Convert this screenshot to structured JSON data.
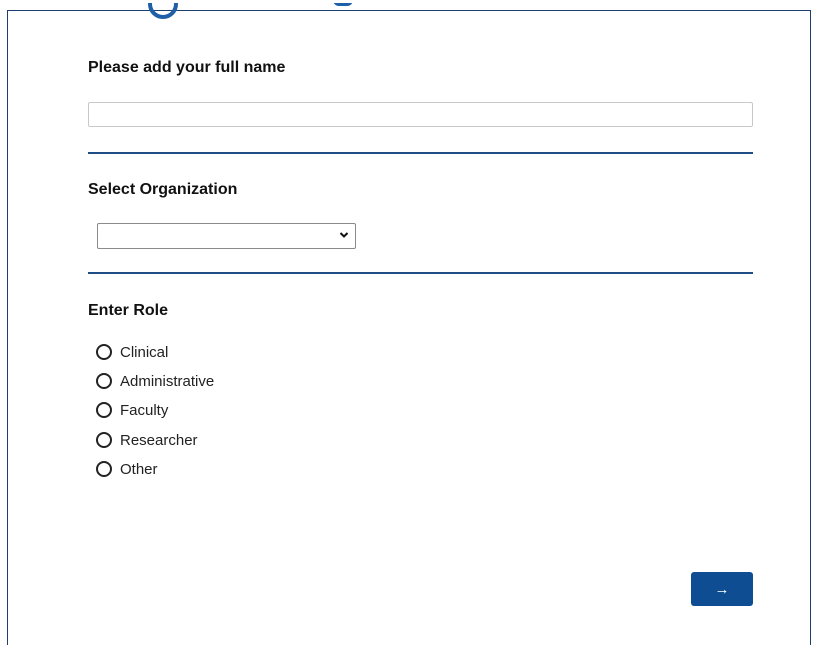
{
  "questions": {
    "full_name": {
      "label": "Please add your full name",
      "value": "",
      "placeholder": ""
    },
    "organization": {
      "label": "Select Organization",
      "selected": ""
    },
    "role": {
      "label": "Enter Role",
      "options": [
        "Clinical",
        "Administrative",
        "Faculty",
        "Researcher",
        "Other"
      ]
    }
  },
  "navigation": {
    "next_label": "→"
  },
  "colors": {
    "accent": "#0e4d92",
    "divider": "#1f4e86",
    "frame": "#1d3f6e"
  },
  "icons": {
    "select_arrow": "chevron-down-icon",
    "radio": "radio-unchecked-icon"
  }
}
